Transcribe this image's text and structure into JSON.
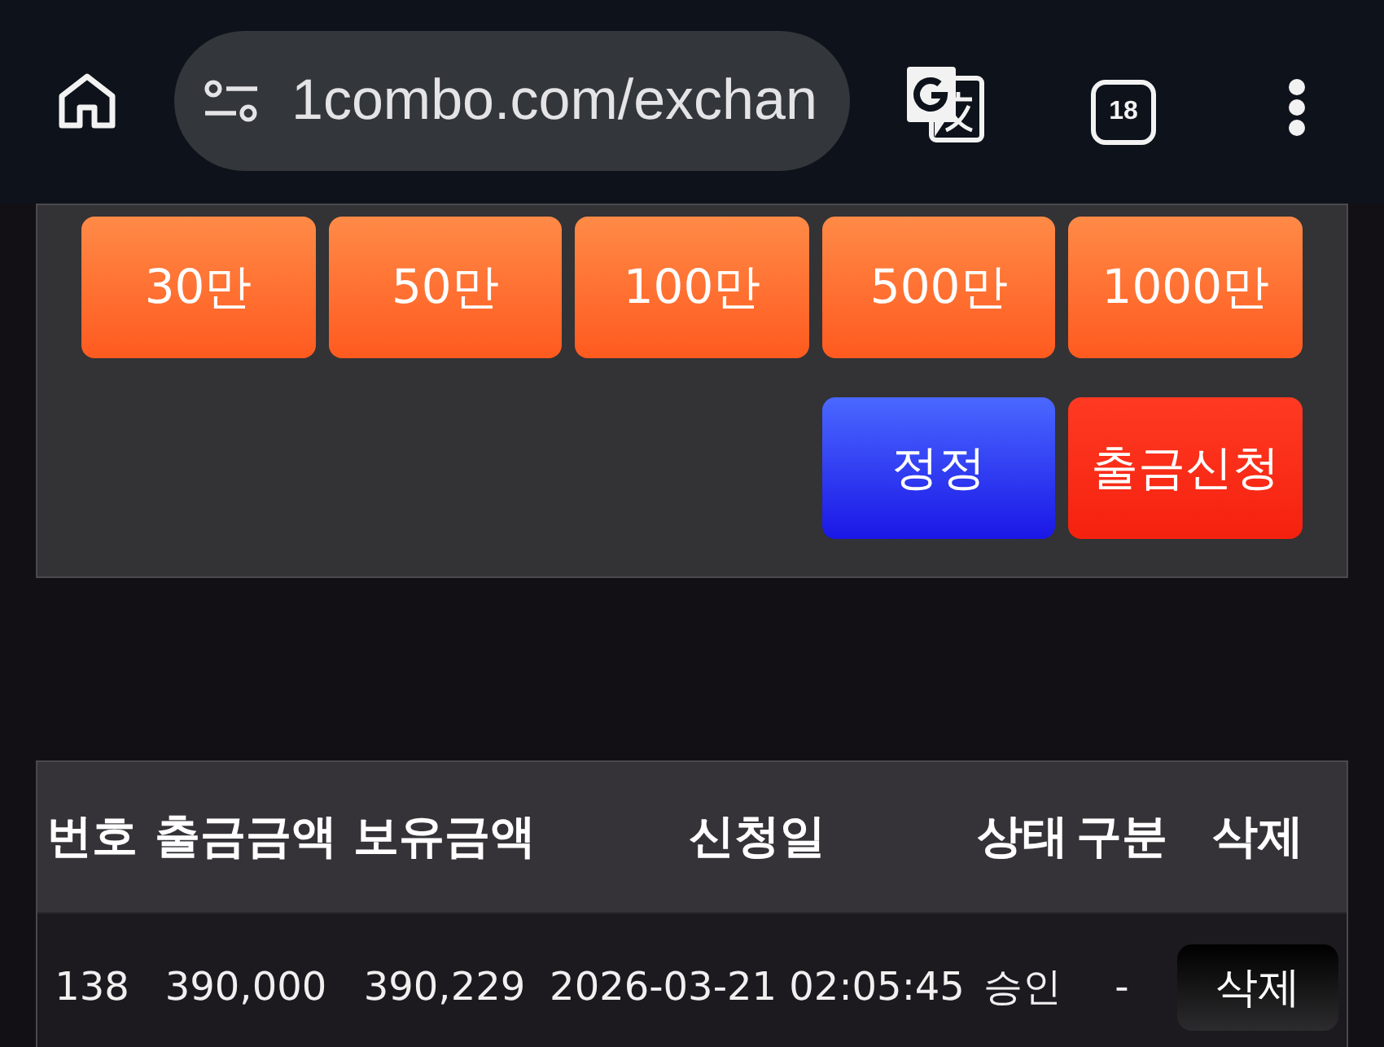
{
  "browser": {
    "url": "1combo.com/exchan",
    "tab_count": "18"
  },
  "amount_buttons": [
    {
      "label": "30만"
    },
    {
      "label": "50만"
    },
    {
      "label": "100만"
    },
    {
      "label": "500만"
    },
    {
      "label": "1000만"
    }
  ],
  "action_buttons": [
    {
      "label": "정정",
      "kind": "correct"
    },
    {
      "label": "출금신청",
      "kind": "request"
    }
  ],
  "withdrawals": {
    "columns": [
      "번호",
      "출금금액",
      "보유금액",
      "신청일",
      "상태",
      "구분",
      "삭제"
    ],
    "rows": [
      {
        "cells": [
          "138",
          "390,000",
          "390,229",
          "2026-03-21 02:05:45",
          "승인",
          "-"
        ],
        "action": "삭제"
      }
    ]
  }
}
